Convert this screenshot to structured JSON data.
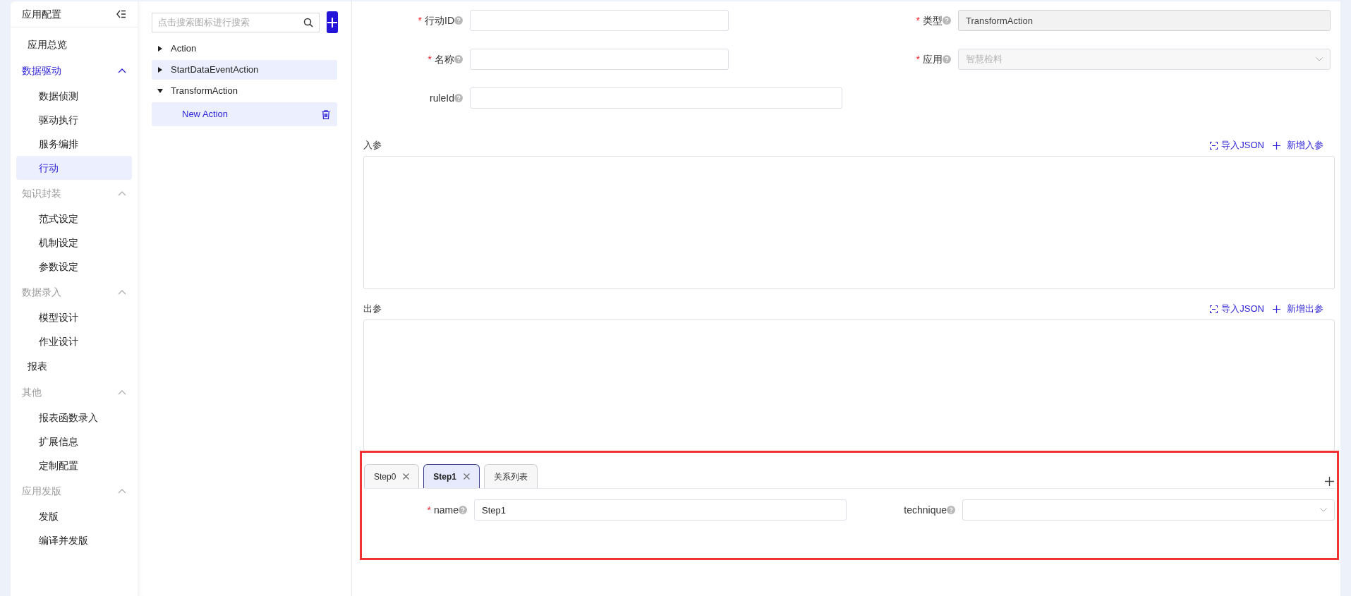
{
  "sidebar": {
    "title": "应用配置",
    "items": [
      {
        "kind": "link",
        "label": "应用总览",
        "selected": false
      },
      {
        "kind": "group",
        "label": "数据驱动",
        "expanded": true,
        "children": [
          {
            "label": "数据侦测",
            "selected": false
          },
          {
            "label": "驱动执行",
            "selected": false
          },
          {
            "label": "服务编排",
            "selected": false
          },
          {
            "label": "行动",
            "selected": true
          }
        ]
      },
      {
        "kind": "group",
        "label": "知识封装",
        "expanded": true,
        "children": [
          {
            "label": "范式设定",
            "selected": false
          },
          {
            "label": "机制设定",
            "selected": false
          },
          {
            "label": "参数设定",
            "selected": false
          }
        ]
      },
      {
        "kind": "group",
        "label": "数据录入",
        "expanded": true,
        "children": [
          {
            "label": "模型设计",
            "selected": false
          },
          {
            "label": "作业设计",
            "selected": false
          }
        ]
      },
      {
        "kind": "link",
        "label": "报表",
        "selected": false
      },
      {
        "kind": "group",
        "label": "其他",
        "expanded": true,
        "children": [
          {
            "label": "报表函数录入",
            "selected": false
          },
          {
            "label": "扩展信息",
            "selected": false
          },
          {
            "label": "定制配置",
            "selected": false
          }
        ]
      },
      {
        "kind": "group",
        "label": "应用发版",
        "expanded": true,
        "children": [
          {
            "label": "发版",
            "selected": false
          },
          {
            "label": "编译并发版",
            "selected": false
          }
        ]
      }
    ]
  },
  "tree": {
    "search": {
      "placeholder": "点击搜索图标进行搜索"
    },
    "nodes": [
      {
        "label": "Action",
        "expanded": false,
        "selected": false,
        "hovered": false
      },
      {
        "label": "StartDataEventAction",
        "expanded": false,
        "selected": false,
        "hovered": true
      },
      {
        "label": "TransformAction",
        "expanded": true,
        "selected": false,
        "hovered": false,
        "children": [
          {
            "label": "New Action",
            "selected": true
          }
        ]
      }
    ]
  },
  "form": {
    "fields": [
      {
        "label": "行动ID",
        "required_mark": "*",
        "kind": "input"
      },
      {
        "label": "类型",
        "required_mark": "*",
        "kind": "input",
        "value": "TransformAction",
        "disabled": true
      },
      {
        "label": "名称",
        "required_mark": "*",
        "kind": "input"
      },
      {
        "label": "应用",
        "required_mark": "*",
        "kind": "select",
        "value": "智慧检料",
        "disabled": true
      },
      {
        "label": "ruleId",
        "kind": "input"
      }
    ]
  },
  "params": [
    {
      "label": "入参",
      "actions": [
        {
          "kind": "import",
          "label": "导入JSON"
        },
        {
          "kind": "add",
          "label": "新增入参"
        }
      ]
    },
    {
      "label": "出参",
      "actions": [
        {
          "kind": "import",
          "label": "导入JSON"
        },
        {
          "kind": "add",
          "label": "新增出参"
        }
      ]
    }
  ],
  "steps": {
    "tabs": [
      {
        "label": "Step0",
        "closable": true,
        "selected": false
      },
      {
        "label": "Step1",
        "closable": true,
        "selected": true
      },
      {
        "label": "关系列表",
        "closable": false,
        "selected": false
      }
    ],
    "fields": [
      {
        "label": "name",
        "required_mark": "*",
        "kind": "input",
        "value": "Step1"
      },
      {
        "label": "technique",
        "kind": "select"
      }
    ]
  }
}
